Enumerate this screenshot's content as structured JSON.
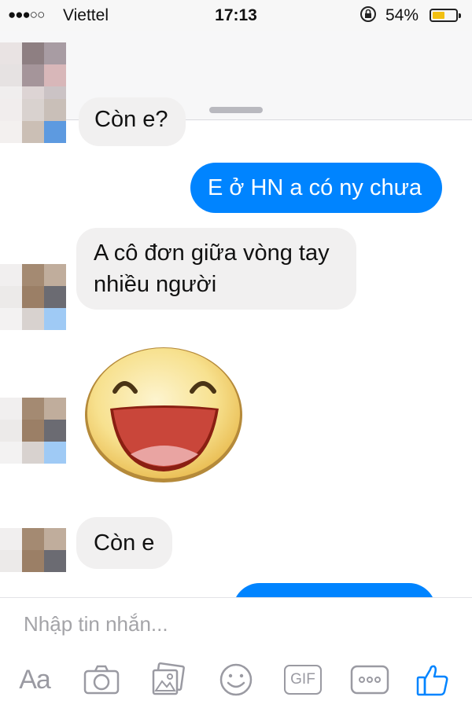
{
  "status_bar": {
    "signal": "●●●○○",
    "carrier": "Viettel",
    "time": "17:13",
    "battery_percent": "54%",
    "battery_level": 0.54
  },
  "header": {
    "contact_name": ""
  },
  "messages": [
    {
      "direction": "in",
      "text": "Còn e?",
      "partial": true
    },
    {
      "direction": "out",
      "text": "E ở HN a có ny chưa"
    },
    {
      "direction": "in",
      "text_line1": "A cô đơn giữa vòng tay",
      "text_line2": "nhiều người"
    },
    {
      "direction": "in",
      "type": "sticker",
      "icon": "laughing-face-sticker"
    },
    {
      "direction": "in",
      "text": "Còn e"
    },
    {
      "direction": "out",
      "text": "",
      "partial": true
    }
  ],
  "composer": {
    "placeholder": "Nhập tin nhắn...",
    "aa_label": "Aa",
    "gif_label": "GIF"
  },
  "toolbar_icons": [
    "text-format-icon",
    "camera-icon",
    "gallery-icon",
    "emoji-icon",
    "gif-icon",
    "more-icon",
    "like-icon"
  ],
  "colors": {
    "accent": "#0084ff",
    "incoming_bubble": "#f1f0f0",
    "battery": "#f2c012"
  }
}
